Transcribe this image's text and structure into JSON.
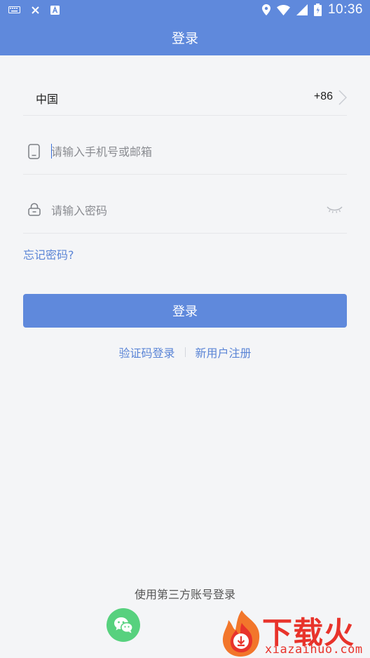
{
  "status_bar": {
    "time": "10:36",
    "left_icons": [
      "keyboard-icon",
      "close-icon",
      "text-a-icon"
    ],
    "right_icons": [
      "location-icon",
      "wifi-icon",
      "signal-icon",
      "battery-icon"
    ]
  },
  "header": {
    "title": "登录"
  },
  "country": {
    "name": "中国",
    "code": "+86"
  },
  "phone": {
    "placeholder": "请输入手机号或邮箱"
  },
  "password": {
    "placeholder": "请输入密码"
  },
  "forgot_label": "忘记密码?",
  "login_button": "登录",
  "links": {
    "sms_login": "验证码登录",
    "register": "新用户注册"
  },
  "third_party": {
    "label": "使用第三方账号登录"
  },
  "watermark": {
    "title": "下载火",
    "url": "xiazaihuo.com"
  },
  "colors": {
    "accent": "#5f89dc",
    "link": "#5b85d6",
    "background": "#f4f5f7",
    "wechat": "#57d17e",
    "watermark": "#e8332b"
  }
}
